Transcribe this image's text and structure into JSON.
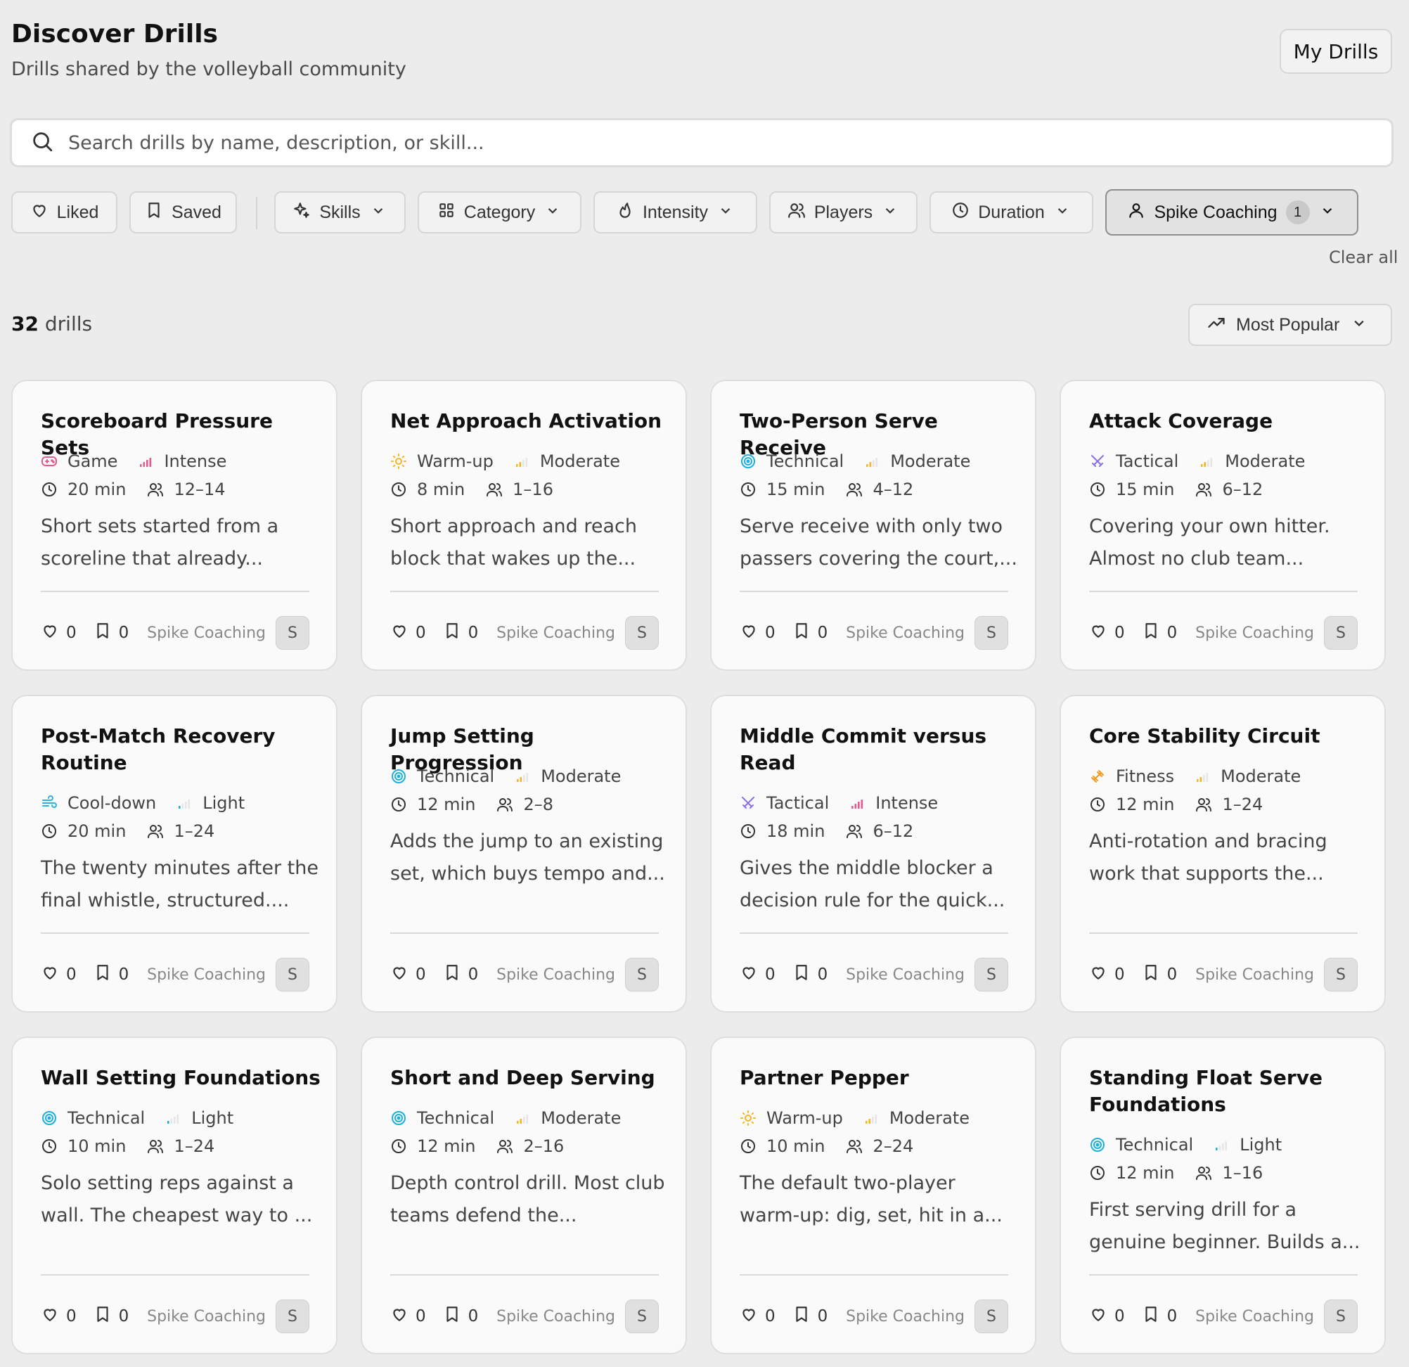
{
  "header": {
    "title": "Discover Drills",
    "subtitle": "Drills shared by the volleyball community",
    "my_drills_label": "My Drills"
  },
  "search": {
    "placeholder": "Search drills by name, description, or skill..."
  },
  "filters": {
    "liked": "Liked",
    "saved": "Saved",
    "skills": "Skills",
    "category": "Category",
    "intensity": "Intensity",
    "players": "Players",
    "duration": "Duration",
    "author": "Spike Coaching",
    "author_count": "1",
    "clear_all": "Clear all"
  },
  "results": {
    "count": "32",
    "count_label": "drills",
    "sort_label": "Most Popular"
  },
  "colors": {
    "game": "#e45a8e",
    "warmup": "#f2b61f",
    "technical": "#1fb0d8",
    "tactical": "#8b6fe0",
    "fitness": "#f29a1f",
    "cooldown": "#2bb3e0",
    "intensity_intense": "#e45a8e",
    "intensity_moderate": "#f2b61f",
    "intensity_light": "#1fb0d8"
  },
  "cards": [
    {
      "title": "Scoreboard Pressure Sets",
      "category": "Game",
      "category_icon": "gamepad-icon",
      "intensity": "Intense",
      "duration": "20 min",
      "players": "12–14",
      "desc": "Short sets started from a scoreline that already...",
      "likes": "0",
      "saves": "0",
      "author": "Spike Coaching",
      "avatar": "S"
    },
    {
      "title": "Net Approach Activation",
      "category": "Warm-up",
      "category_icon": "sun-icon",
      "intensity": "Moderate",
      "duration": "8 min",
      "players": "1–16",
      "desc": "Short approach and reach block that wakes up the...",
      "likes": "0",
      "saves": "0",
      "author": "Spike Coaching",
      "avatar": "S"
    },
    {
      "title": "Two-Person Serve Receive",
      "category": "Technical",
      "category_icon": "target-icon",
      "intensity": "Moderate",
      "duration": "15 min",
      "players": "4–12",
      "desc": "Serve receive with only two passers covering the court,...",
      "likes": "0",
      "saves": "0",
      "author": "Spike Coaching",
      "avatar": "S"
    },
    {
      "title": "Attack Coverage",
      "category": "Tactical",
      "category_icon": "swords-icon",
      "intensity": "Moderate",
      "duration": "15 min",
      "players": "6–12",
      "desc": "Covering your own hitter. Almost no club team...",
      "likes": "0",
      "saves": "0",
      "author": "Spike Coaching",
      "avatar": "S"
    },
    {
      "title": "Post-Match Recovery Routine",
      "category": "Cool-down",
      "category_icon": "wind-icon",
      "intensity": "Light",
      "duration": "20 min",
      "players": "1–24",
      "desc": "The twenty minutes after the final whistle, structured....",
      "likes": "0",
      "saves": "0",
      "author": "Spike Coaching",
      "avatar": "S"
    },
    {
      "title": "Jump Setting Progression",
      "category": "Technical",
      "category_icon": "target-icon",
      "intensity": "Moderate",
      "duration": "12 min",
      "players": "2–8",
      "desc": "Adds the jump to an existing set, which buys tempo and...",
      "likes": "0",
      "saves": "0",
      "author": "Spike Coaching",
      "avatar": "S"
    },
    {
      "title": "Middle Commit versus Read",
      "category": "Tactical",
      "category_icon": "swords-icon",
      "intensity": "Intense",
      "duration": "18 min",
      "players": "6–12",
      "desc": "Gives the middle blocker a decision rule for the quick...",
      "likes": "0",
      "saves": "0",
      "author": "Spike Coaching",
      "avatar": "S"
    },
    {
      "title": "Core Stability Circuit",
      "category": "Fitness",
      "category_icon": "dumbbell-icon",
      "intensity": "Moderate",
      "duration": "12 min",
      "players": "1–24",
      "desc": "Anti-rotation and bracing work that supports the...",
      "likes": "0",
      "saves": "0",
      "author": "Spike Coaching",
      "avatar": "S"
    },
    {
      "title": "Wall Setting Foundations",
      "category": "Technical",
      "category_icon": "target-icon",
      "intensity": "Light",
      "duration": "10 min",
      "players": "1–24",
      "desc": "Solo setting reps against a wall. The cheapest way to ...",
      "likes": "0",
      "saves": "0",
      "author": "Spike Coaching",
      "avatar": "S"
    },
    {
      "title": "Short and Deep Serving",
      "category": "Technical",
      "category_icon": "target-icon",
      "intensity": "Moderate",
      "duration": "12 min",
      "players": "2–16",
      "desc": "Depth control drill. Most club teams defend the...",
      "likes": "0",
      "saves": "0",
      "author": "Spike Coaching",
      "avatar": "S"
    },
    {
      "title": "Partner Pepper",
      "category": "Warm-up",
      "category_icon": "sun-icon",
      "intensity": "Moderate",
      "duration": "10 min",
      "players": "2–24",
      "desc": "The default two-player warm-up: dig, set, hit in a...",
      "likes": "0",
      "saves": "0",
      "author": "Spike Coaching",
      "avatar": "S"
    },
    {
      "title": "Standing Float Serve Foundations",
      "category": "Technical",
      "category_icon": "target-icon",
      "intensity": "Light",
      "duration": "12 min",
      "players": "1–16",
      "desc": "First serving drill for a genuine beginner. Builds a...",
      "likes": "0",
      "saves": "0",
      "author": "Spike Coaching",
      "avatar": "S"
    }
  ]
}
